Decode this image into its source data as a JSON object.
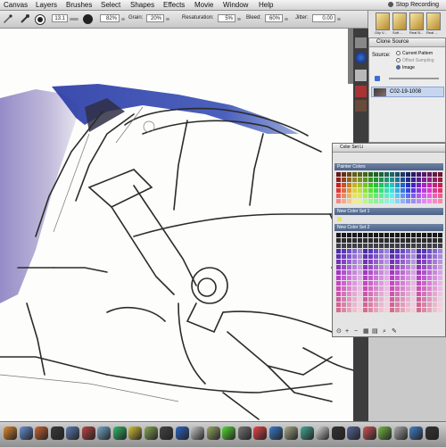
{
  "menu": {
    "items": [
      "Canvas",
      "Layers",
      "Brushes",
      "Select",
      "Shapes",
      "Effects",
      "Movie",
      "Window",
      "Help"
    ],
    "recording_label": "Stop Recording"
  },
  "property_bar": {
    "size_value": "13.1",
    "opacity_value": "82%",
    "grain_label": "Grain:",
    "grain_value": "20%",
    "resaturation_label": "Resaturation:",
    "resaturation_value": "5%",
    "bleed_label": "Bleed:",
    "bleed_value": "60%",
    "jitter_label": "Jitter:",
    "jitter_value": "0.00"
  },
  "brush_selector": {
    "captions": [
      "Oily V...",
      "Soft ...",
      "Real B...",
      "Real ..."
    ]
  },
  "clone_source": {
    "title": "Clone Source",
    "source_label": "Source:",
    "options": [
      "Current Pattern",
      "Offset Sampling",
      "Image"
    ],
    "selected_option": "Image",
    "image_name": "C02-19-1008"
  },
  "color_set": {
    "title": "Color Set Li",
    "sets": [
      "Painter Colors",
      "New Color Set 1",
      "New Color Set 2"
    ],
    "accent": "#3a6fd1"
  }
}
